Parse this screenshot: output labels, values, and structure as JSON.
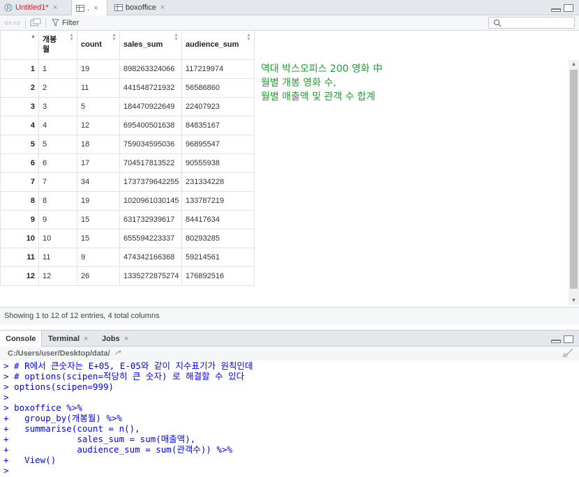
{
  "editor_tabs": [
    {
      "label": "Untitled1*",
      "modified": true
    },
    {
      "label": ".",
      "modified": false
    },
    {
      "label": "boxoffice",
      "modified": false
    }
  ],
  "toolbar": {
    "filter_label": "Filter",
    "search_placeholder": ""
  },
  "table": {
    "columns": [
      "개봉\n월",
      "count",
      "sales_sum",
      "audience_sum"
    ],
    "rows": [
      {
        "n": "1",
        "month": "1",
        "count": "19",
        "sales_sum": "898263324066",
        "audience_sum": "117219974"
      },
      {
        "n": "2",
        "month": "2",
        "count": "11",
        "sales_sum": "441548721932",
        "audience_sum": "56586860"
      },
      {
        "n": "3",
        "month": "3",
        "count": "5",
        "sales_sum": "184470922649",
        "audience_sum": "22407923"
      },
      {
        "n": "4",
        "month": "4",
        "count": "12",
        "sales_sum": "695400501638",
        "audience_sum": "84835167"
      },
      {
        "n": "5",
        "month": "5",
        "count": "18",
        "sales_sum": "759034595036",
        "audience_sum": "96895547"
      },
      {
        "n": "6",
        "month": "6",
        "count": "17",
        "sales_sum": "704517813522",
        "audience_sum": "90555938"
      },
      {
        "n": "7",
        "month": "7",
        "count": "34",
        "sales_sum": "1737379642255",
        "audience_sum": "231334228"
      },
      {
        "n": "8",
        "month": "8",
        "count": "19",
        "sales_sum": "1020961030145",
        "audience_sum": "133787219"
      },
      {
        "n": "9",
        "month": "9",
        "count": "15",
        "sales_sum": "631732939617",
        "audience_sum": "84417634"
      },
      {
        "n": "10",
        "month": "10",
        "count": "15",
        "sales_sum": "655594223337",
        "audience_sum": "80293285"
      },
      {
        "n": "11",
        "month": "11",
        "count": "9",
        "sales_sum": "474342166368",
        "audience_sum": "59214561"
      },
      {
        "n": "12",
        "month": "12",
        "count": "26",
        "sales_sum": "1335272875274",
        "audience_sum": "176892516"
      }
    ]
  },
  "annotation": [
    "역대 박스오피스 200 영화 中",
    "월별 개봉 영화 수,",
    "월별 매출액 및 관객 수 합계"
  ],
  "status_text": "Showing 1 to 12 of 12 entries, 4 total columns",
  "console_tabs": [
    {
      "label": "Console",
      "closable": false
    },
    {
      "label": "Terminal",
      "closable": true
    },
    {
      "label": "Jobs",
      "closable": true
    }
  ],
  "console_path": "C:/Users/user/Desktop/data/",
  "console_lines": [
    "> # R에서 큰숫자는 E+05, E-05와 같이 지수표기가 원칙인데",
    "> # options(scipen=적당히 큰 숫자) 로 해결할 수 있다",
    "> options(scipen=999)",
    ">",
    "> boxoffice %>%",
    "+   group_by(개봉월) %>%",
    "+   summarise(count = n(),",
    "+             sales_sum = sum(매출액),",
    "+             audience_sum = sum(관객수)) %>%",
    "+   View()",
    ">"
  ],
  "colors": {
    "annotation": "#1e9e2e",
    "console_text": "#0000ff",
    "modified_tab": "#d02020"
  }
}
